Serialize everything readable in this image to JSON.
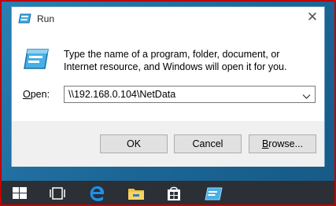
{
  "dialog": {
    "title": "Run",
    "close_glyph": "✕",
    "description": "Type the name of a program, folder, document, or Internet resource, and Windows will open it for you.",
    "open_label_mnemonic": "O",
    "open_label_rest": "pen:",
    "open_value": "\\\\192.168.0.104\\NetData",
    "buttons": {
      "ok": "OK",
      "cancel": "Cancel",
      "browse_mnemonic": "B",
      "browse_rest": "rowse..."
    }
  },
  "icons": {
    "title": "run-app-icon",
    "large": "run-app-icon",
    "dropdown": "chevron-down-icon",
    "close": "close-icon"
  },
  "taskbar": {
    "items": [
      "windows-start-icon",
      "task-view-icon",
      "edge-browser-icon",
      "file-explorer-icon",
      "store-icon",
      "run-app-icon"
    ]
  },
  "colors": {
    "accent": "#0078d7",
    "taskbar": "#2b2f36",
    "desktop": "#1e6fa0",
    "highlight_frame": "#c00000"
  }
}
